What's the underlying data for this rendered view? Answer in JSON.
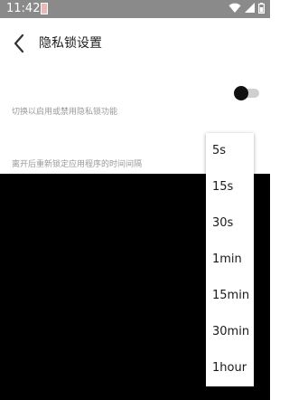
{
  "status_bar": {
    "time": "11:42",
    "icons": [
      "wifi-icon",
      "cellular-signal-icon",
      "battery-icon"
    ]
  },
  "header": {
    "back_icon": "chevron-left-icon",
    "title": "隐私锁设置"
  },
  "settings": {
    "privacy_lock": {
      "description": "切换以启用或禁用隐私锁功能",
      "enabled": false
    },
    "lock_delay": {
      "description": "离开后重新锁定应用程序的时间间隔"
    }
  },
  "dropdown": {
    "options": [
      "5s",
      "15s",
      "30s",
      "1min",
      "15min",
      "30min",
      "1hour"
    ]
  },
  "colors": {
    "status_bar": "#8a8a8a",
    "overlay": "#000000",
    "toggle_thumb": "#111111",
    "toggle_track": "#cfcfcf"
  }
}
